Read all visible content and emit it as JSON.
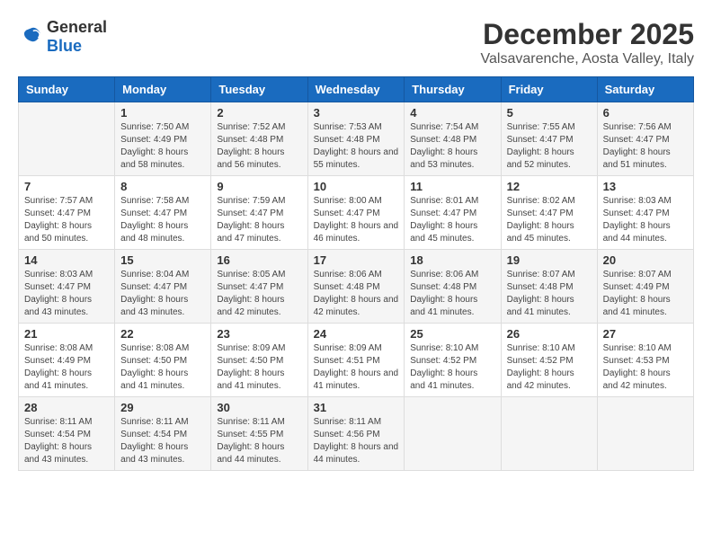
{
  "header": {
    "logo_general": "General",
    "logo_blue": "Blue",
    "month": "December 2025",
    "location": "Valsavarenche, Aosta Valley, Italy"
  },
  "days_of_week": [
    "Sunday",
    "Monday",
    "Tuesday",
    "Wednesday",
    "Thursday",
    "Friday",
    "Saturday"
  ],
  "weeks": [
    [
      {
        "day": "",
        "sunrise": "",
        "sunset": "",
        "daylight": ""
      },
      {
        "day": "1",
        "sunrise": "Sunrise: 7:50 AM",
        "sunset": "Sunset: 4:49 PM",
        "daylight": "Daylight: 8 hours and 58 minutes."
      },
      {
        "day": "2",
        "sunrise": "Sunrise: 7:52 AM",
        "sunset": "Sunset: 4:48 PM",
        "daylight": "Daylight: 8 hours and 56 minutes."
      },
      {
        "day": "3",
        "sunrise": "Sunrise: 7:53 AM",
        "sunset": "Sunset: 4:48 PM",
        "daylight": "Daylight: 8 hours and 55 minutes."
      },
      {
        "day": "4",
        "sunrise": "Sunrise: 7:54 AM",
        "sunset": "Sunset: 4:48 PM",
        "daylight": "Daylight: 8 hours and 53 minutes."
      },
      {
        "day": "5",
        "sunrise": "Sunrise: 7:55 AM",
        "sunset": "Sunset: 4:47 PM",
        "daylight": "Daylight: 8 hours and 52 minutes."
      },
      {
        "day": "6",
        "sunrise": "Sunrise: 7:56 AM",
        "sunset": "Sunset: 4:47 PM",
        "daylight": "Daylight: 8 hours and 51 minutes."
      }
    ],
    [
      {
        "day": "7",
        "sunrise": "Sunrise: 7:57 AM",
        "sunset": "Sunset: 4:47 PM",
        "daylight": "Daylight: 8 hours and 50 minutes."
      },
      {
        "day": "8",
        "sunrise": "Sunrise: 7:58 AM",
        "sunset": "Sunset: 4:47 PM",
        "daylight": "Daylight: 8 hours and 48 minutes."
      },
      {
        "day": "9",
        "sunrise": "Sunrise: 7:59 AM",
        "sunset": "Sunset: 4:47 PM",
        "daylight": "Daylight: 8 hours and 47 minutes."
      },
      {
        "day": "10",
        "sunrise": "Sunrise: 8:00 AM",
        "sunset": "Sunset: 4:47 PM",
        "daylight": "Daylight: 8 hours and 46 minutes."
      },
      {
        "day": "11",
        "sunrise": "Sunrise: 8:01 AM",
        "sunset": "Sunset: 4:47 PM",
        "daylight": "Daylight: 8 hours and 45 minutes."
      },
      {
        "day": "12",
        "sunrise": "Sunrise: 8:02 AM",
        "sunset": "Sunset: 4:47 PM",
        "daylight": "Daylight: 8 hours and 45 minutes."
      },
      {
        "day": "13",
        "sunrise": "Sunrise: 8:03 AM",
        "sunset": "Sunset: 4:47 PM",
        "daylight": "Daylight: 8 hours and 44 minutes."
      }
    ],
    [
      {
        "day": "14",
        "sunrise": "Sunrise: 8:03 AM",
        "sunset": "Sunset: 4:47 PM",
        "daylight": "Daylight: 8 hours and 43 minutes."
      },
      {
        "day": "15",
        "sunrise": "Sunrise: 8:04 AM",
        "sunset": "Sunset: 4:47 PM",
        "daylight": "Daylight: 8 hours and 43 minutes."
      },
      {
        "day": "16",
        "sunrise": "Sunrise: 8:05 AM",
        "sunset": "Sunset: 4:47 PM",
        "daylight": "Daylight: 8 hours and 42 minutes."
      },
      {
        "day": "17",
        "sunrise": "Sunrise: 8:06 AM",
        "sunset": "Sunset: 4:48 PM",
        "daylight": "Daylight: 8 hours and 42 minutes."
      },
      {
        "day": "18",
        "sunrise": "Sunrise: 8:06 AM",
        "sunset": "Sunset: 4:48 PM",
        "daylight": "Daylight: 8 hours and 41 minutes."
      },
      {
        "day": "19",
        "sunrise": "Sunrise: 8:07 AM",
        "sunset": "Sunset: 4:48 PM",
        "daylight": "Daylight: 8 hours and 41 minutes."
      },
      {
        "day": "20",
        "sunrise": "Sunrise: 8:07 AM",
        "sunset": "Sunset: 4:49 PM",
        "daylight": "Daylight: 8 hours and 41 minutes."
      }
    ],
    [
      {
        "day": "21",
        "sunrise": "Sunrise: 8:08 AM",
        "sunset": "Sunset: 4:49 PM",
        "daylight": "Daylight: 8 hours and 41 minutes."
      },
      {
        "day": "22",
        "sunrise": "Sunrise: 8:08 AM",
        "sunset": "Sunset: 4:50 PM",
        "daylight": "Daylight: 8 hours and 41 minutes."
      },
      {
        "day": "23",
        "sunrise": "Sunrise: 8:09 AM",
        "sunset": "Sunset: 4:50 PM",
        "daylight": "Daylight: 8 hours and 41 minutes."
      },
      {
        "day": "24",
        "sunrise": "Sunrise: 8:09 AM",
        "sunset": "Sunset: 4:51 PM",
        "daylight": "Daylight: 8 hours and 41 minutes."
      },
      {
        "day": "25",
        "sunrise": "Sunrise: 8:10 AM",
        "sunset": "Sunset: 4:52 PM",
        "daylight": "Daylight: 8 hours and 41 minutes."
      },
      {
        "day": "26",
        "sunrise": "Sunrise: 8:10 AM",
        "sunset": "Sunset: 4:52 PM",
        "daylight": "Daylight: 8 hours and 42 minutes."
      },
      {
        "day": "27",
        "sunrise": "Sunrise: 8:10 AM",
        "sunset": "Sunset: 4:53 PM",
        "daylight": "Daylight: 8 hours and 42 minutes."
      }
    ],
    [
      {
        "day": "28",
        "sunrise": "Sunrise: 8:11 AM",
        "sunset": "Sunset: 4:54 PM",
        "daylight": "Daylight: 8 hours and 43 minutes."
      },
      {
        "day": "29",
        "sunrise": "Sunrise: 8:11 AM",
        "sunset": "Sunset: 4:54 PM",
        "daylight": "Daylight: 8 hours and 43 minutes."
      },
      {
        "day": "30",
        "sunrise": "Sunrise: 8:11 AM",
        "sunset": "Sunset: 4:55 PM",
        "daylight": "Daylight: 8 hours and 44 minutes."
      },
      {
        "day": "31",
        "sunrise": "Sunrise: 8:11 AM",
        "sunset": "Sunset: 4:56 PM",
        "daylight": "Daylight: 8 hours and 44 minutes."
      },
      {
        "day": "",
        "sunrise": "",
        "sunset": "",
        "daylight": ""
      },
      {
        "day": "",
        "sunrise": "",
        "sunset": "",
        "daylight": ""
      },
      {
        "day": "",
        "sunrise": "",
        "sunset": "",
        "daylight": ""
      }
    ]
  ]
}
